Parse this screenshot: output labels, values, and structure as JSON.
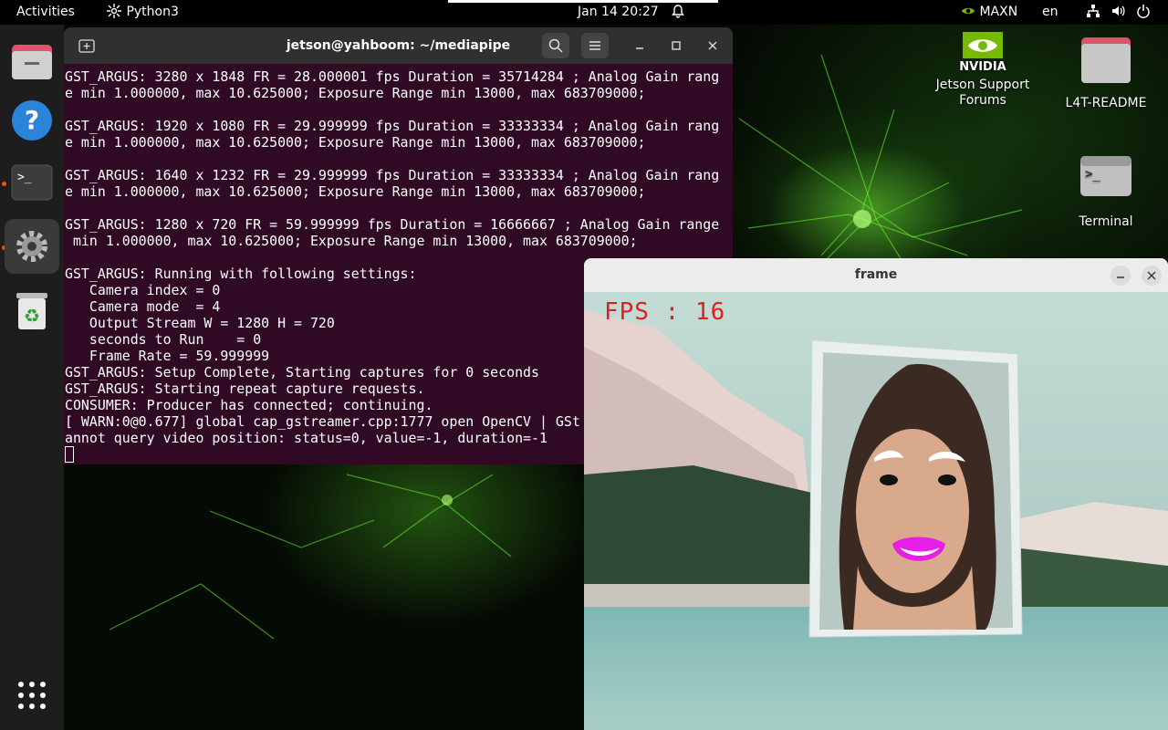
{
  "topbar": {
    "activities": "Activities",
    "app_name": "Python3",
    "datetime": "Jan 14  20:27",
    "power_mode": "MAXN",
    "language": "en"
  },
  "dock": {
    "items": [
      "files",
      "help",
      "terminal",
      "settings",
      "trash"
    ]
  },
  "terminal": {
    "title": "jetson@yahboom: ~/mediapipe",
    "lines": [
      "GST_ARGUS: 3280 x 1848 FR = 28.000001 fps Duration = 35714284 ; Analog Gain rang",
      "e min 1.000000, max 10.625000; Exposure Range min 13000, max 683709000;",
      "",
      "GST_ARGUS: 1920 x 1080 FR = 29.999999 fps Duration = 33333334 ; Analog Gain rang",
      "e min 1.000000, max 10.625000; Exposure Range min 13000, max 683709000;",
      "",
      "GST_ARGUS: 1640 x 1232 FR = 29.999999 fps Duration = 33333334 ; Analog Gain rang",
      "e min 1.000000, max 10.625000; Exposure Range min 13000, max 683709000;",
      "",
      "GST_ARGUS: 1280 x 720 FR = 59.999999 fps Duration = 16666667 ; Analog Gain range",
      " min 1.000000, max 10.625000; Exposure Range min 13000, max 683709000;",
      "",
      "GST_ARGUS: Running with following settings:",
      "   Camera index = 0",
      "   Camera mode  = 4",
      "   Output Stream W = 1280 H = 720",
      "   seconds to Run    = 0",
      "   Frame Rate = 59.999999",
      "GST_ARGUS: Setup Complete, Starting captures for 0 seconds",
      "GST_ARGUS: Starting repeat capture requests.",
      "CONSUMER: Producer has connected; continuing.",
      "[ WARN:0@0.677] global cap_gstreamer.cpp:1777 open OpenCV | GSt",
      "annot query video position: status=0, value=-1, duration=-1"
    ]
  },
  "desktop": {
    "nvidia_label_1": "Jetson Support",
    "nvidia_label_2": "Forums",
    "readme_label": "L4T-README",
    "terminal_label": "Terminal"
  },
  "frame": {
    "title": "frame",
    "fps_text": "FPS : 16"
  },
  "colors": {
    "terminal_bg": "#300a24",
    "accent_dot": "#e95420",
    "fps_text": "#e02020",
    "lip_overlay": "#e61ee6"
  }
}
